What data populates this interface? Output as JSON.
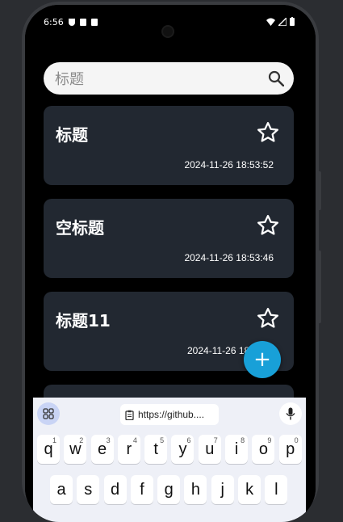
{
  "status": {
    "time": "6:56"
  },
  "search": {
    "placeholder": "标题"
  },
  "notes": [
    {
      "title": "标题",
      "date": "2024-11-26 18:53:52"
    },
    {
      "title": "空标题",
      "date": "2024-11-26 18:53:46"
    },
    {
      "title": "标题11",
      "date": "2024-11-26 18:"
    }
  ],
  "fab": {
    "label": "+"
  },
  "keyboard": {
    "clipboard_text": "https://github....",
    "row1": [
      {
        "key": "q",
        "hint": "1"
      },
      {
        "key": "w",
        "hint": "2"
      },
      {
        "key": "e",
        "hint": "3"
      },
      {
        "key": "r",
        "hint": "4"
      },
      {
        "key": "t",
        "hint": "5"
      },
      {
        "key": "y",
        "hint": "6"
      },
      {
        "key": "u",
        "hint": "7"
      },
      {
        "key": "i",
        "hint": "8"
      },
      {
        "key": "o",
        "hint": "9"
      },
      {
        "key": "p",
        "hint": "0"
      }
    ],
    "row2": [
      "a",
      "s",
      "d",
      "f",
      "g",
      "h",
      "j",
      "k",
      "l"
    ]
  },
  "colors": {
    "background": "#000000",
    "card": "#222831",
    "fab": "#18a0d8",
    "search_bg": "#f5f5f5"
  }
}
